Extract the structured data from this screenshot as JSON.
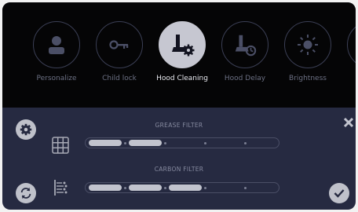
{
  "menu": {
    "items": [
      {
        "label": "Personalize",
        "icon": "person-icon"
      },
      {
        "label": "Child lock",
        "icon": "key-icon"
      },
      {
        "label": "Hood Cleaning",
        "icon": "hood-gear-icon",
        "active": true
      },
      {
        "label": "Hood Delay",
        "icon": "hood-timer-icon"
      },
      {
        "label": "Brightness",
        "icon": "sun-icon"
      },
      {
        "label": "L",
        "icon": "partial-icon"
      }
    ]
  },
  "filters": {
    "grease": {
      "label": "GREASE FILTER",
      "filled_segments": 2,
      "total_segments": 5
    },
    "carbon": {
      "label": "CARBON FILTER",
      "filled_segments": 3,
      "total_segments": 5
    }
  },
  "colors": {
    "background": "#262a41",
    "top_bar": "#050506",
    "accent": "#c6c7d1"
  }
}
